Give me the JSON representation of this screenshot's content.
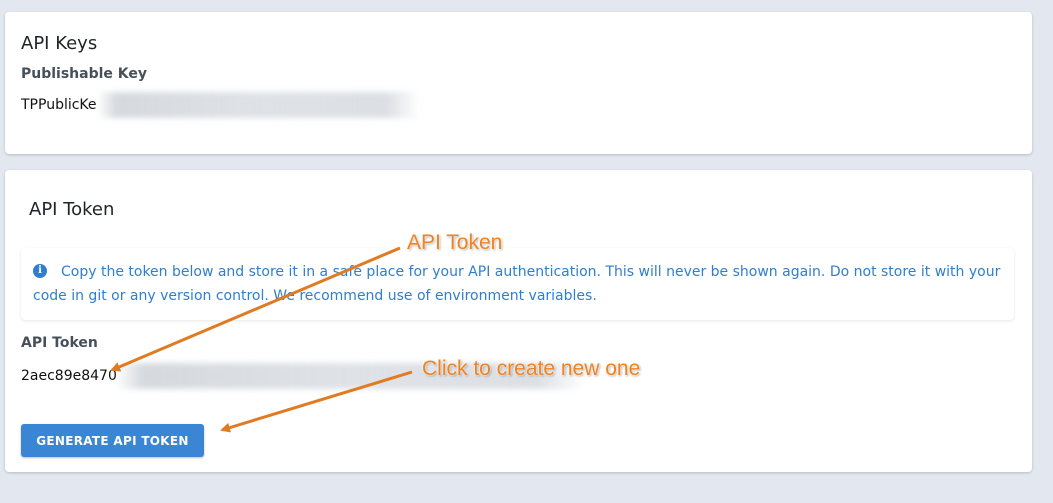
{
  "keys_card": {
    "title": "API Keys",
    "publishable_label": "Publishable Key",
    "publishable_value": "TPPublicKe"
  },
  "token_card": {
    "title": "API Token",
    "info_icon": "info-circle-icon",
    "info_text": "Copy the token below and store it in a safe place for your API authentication. This will never be shown again. Do not store it with your code in git or any version control. We recommend use of environment variables.",
    "token_label": "API Token",
    "token_value": "2aec89e8470",
    "generate_button": "GENERATE API TOKEN"
  },
  "annotations": {
    "token_callout": "API Token",
    "button_callout": "Click to create new one"
  },
  "colors": {
    "page_bg": "#e3e8f0",
    "accent_blue": "#3a86d4",
    "info_blue": "#2f7ecf",
    "annotation_orange": "#f0821f"
  }
}
